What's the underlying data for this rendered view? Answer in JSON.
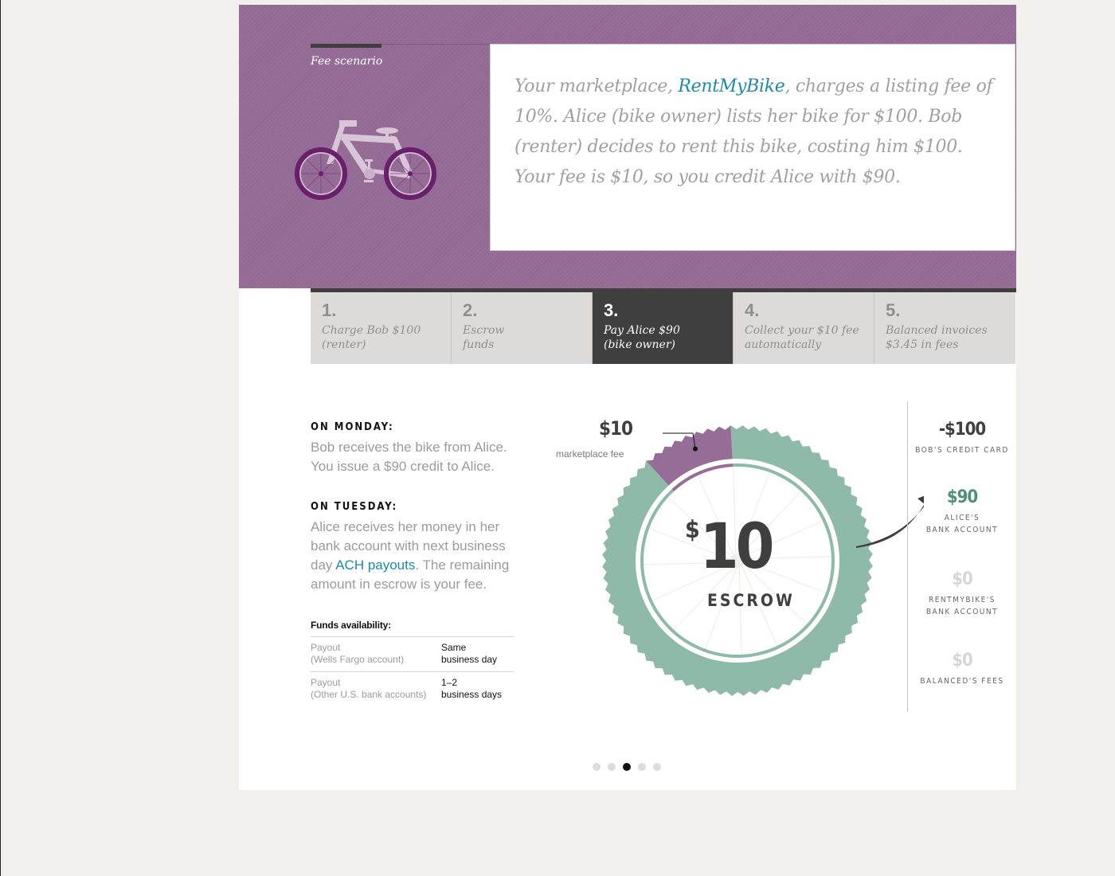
{
  "hero": {
    "label": "Fee scenario",
    "quote_pre": "Your marketplace, ",
    "quote_link": "RentMyBike",
    "quote_post": ", charges a listing fee of 10%. Alice (bike owner) lists her bike for $100. Bob (renter) decides to rent this bike, costing him $100. Your fee is $10, so you credit Alice with $90.",
    "colors": {
      "purple": "#956d96",
      "link": "#1e8aa8"
    }
  },
  "steps": [
    {
      "num": "1.",
      "line1": "Charge Bob $100",
      "line2": "(renter)",
      "active": false
    },
    {
      "num": "2.",
      "line1": "Escrow",
      "line2": "funds",
      "active": false
    },
    {
      "num": "3.",
      "line1": "Pay Alice $90",
      "line2": "(bike owner)",
      "active": true
    },
    {
      "num": "4.",
      "line1": "Collect your $10 fee",
      "line2": "automatically",
      "active": false
    },
    {
      "num": "5.",
      "line1": "Balanced invoices",
      "line2": "$3.45 in fees",
      "active": false
    }
  ],
  "monday": {
    "heading": "ON MONDAY:",
    "text": "Bob receives the bike from Alice. You issue a $90 credit to Alice."
  },
  "tuesday": {
    "heading": "ON TUESDAY:",
    "text_pre": "Alice receives her money in her bank account with next business day ",
    "link": "ACH payouts",
    "text_post": ". The remaining amount in escrow is your fee."
  },
  "funds": {
    "title": "Funds availability:",
    "rows": [
      {
        "k1": "Payout",
        "k2": "(Wells Fargo account)",
        "v1": "Same",
        "v2": "business day"
      },
      {
        "k1": "Payout",
        "k2": "(Other U.S. bank accounts)",
        "v1": "1–2",
        "v2": "business days"
      }
    ]
  },
  "wheel": {
    "fee_amount": "$10",
    "fee_label": "marketplace fee",
    "center_currency": "$",
    "center_amount": "10",
    "center_label": "ESCROW",
    "fee_fraction": 0.1,
    "colors": {
      "tire": "#8fb9a8",
      "fee": "#956d96"
    }
  },
  "accounts": [
    {
      "amount": "-$100",
      "name1": "BOB'S CREDIT CARD",
      "name2": "",
      "color": "#3f3f3f"
    },
    {
      "amount": "$90",
      "name1": "ALICE'S",
      "name2": "BANK ACCOUNT",
      "color": "#4e8f78"
    },
    {
      "amount": "$0",
      "name1": "RENTMYBIKE'S",
      "name2": "BANK ACCOUNT",
      "color": "#d6d6d6"
    },
    {
      "amount": "$0",
      "name1": "BALANCED'S FEES",
      "name2": "",
      "color": "#d6d6d6"
    }
  ],
  "pagination": {
    "total": 5,
    "current": 3
  }
}
